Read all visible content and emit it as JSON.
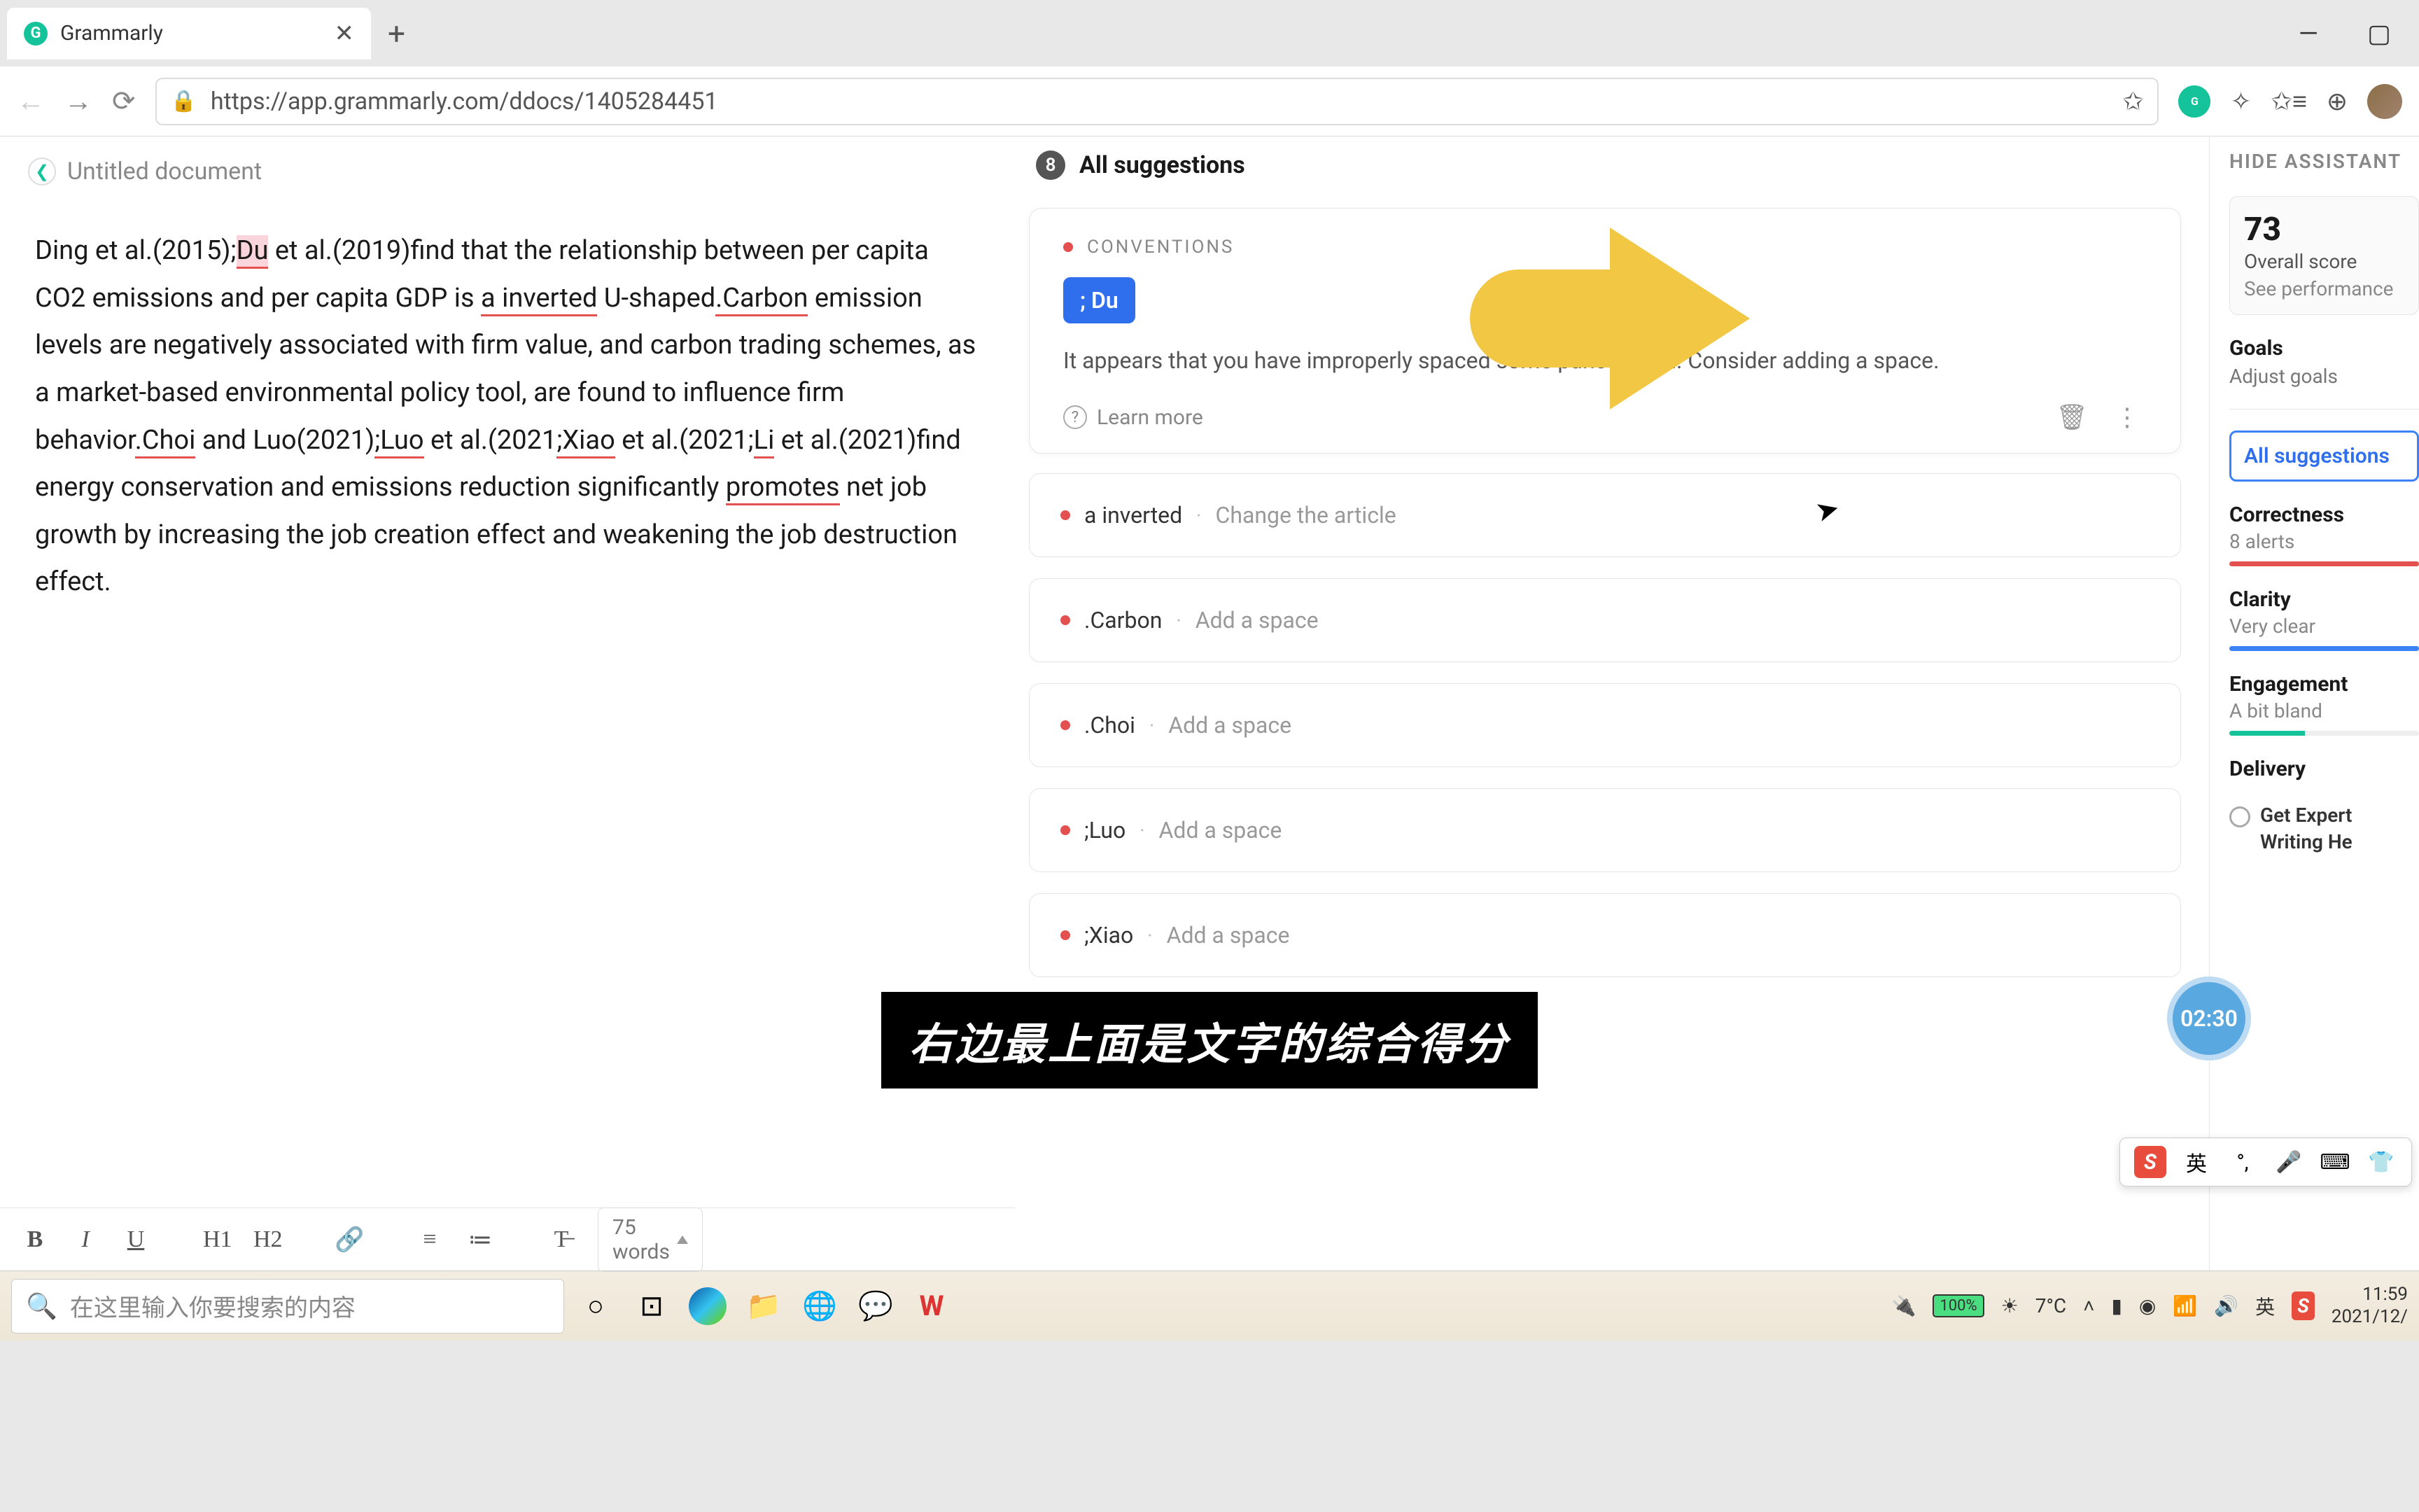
{
  "browser": {
    "tab_title": "Grammarly",
    "url": "https://app.grammarly.com/ddocs/1405284451",
    "window_minimize": "—",
    "window_maximize": "▢"
  },
  "doc": {
    "title": "Untitled document",
    "text_parts": {
      "p1a": "Ding et al.(2015);",
      "p1_du": "Du",
      "p1b": " et al.(2019)find that the relationship between per capita CO2 emissions and per capita GDP is ",
      "p1_a_inverted": "a inverted",
      "p1c": " U-shaped",
      "p1_carbon": ".Carbon",
      "p1d": " emission levels are negatively associated with firm value, and carbon trading schemes, as a market-based environmental policy tool, are found to influence firm behavior",
      "p1_choi": ".Choi",
      "p1e": " and Luo(2021)",
      "p1_luo": ";Luo",
      "p1f": " et al.(2021",
      "p1_xiao": ";Xiao",
      "p1g": " et al.(2021;",
      "p1_li": "Li",
      "p1h": " et al.(2021)find energy conservation and emissions reduction significantly ",
      "p1_promotes": "promotes",
      "p1i": " net job growth by increasing the job creation effect and weakening the job destruction effect."
    }
  },
  "toolbar": {
    "bold": "B",
    "italic": "I",
    "underline": "U",
    "h1": "H1",
    "h2": "H2",
    "link": "🔗",
    "ol": "≡",
    "ul": "≔",
    "clear": "T̶",
    "word_count": "75 words"
  },
  "suggestions": {
    "count": "8",
    "title": "All suggestions",
    "expanded": {
      "category": "CONVENTIONS",
      "fix": "; Du",
      "message": "It appears that you have improperly spaced some punctuation. Consider adding a space.",
      "learn_more": "Learn more"
    },
    "items": [
      {
        "term": "a inverted",
        "action": "Change the article"
      },
      {
        "term": ".Carbon",
        "action": "Add a space"
      },
      {
        "term": ".Choi",
        "action": "Add a space"
      },
      {
        "term": ";Luo",
        "action": "Add a space"
      },
      {
        "term": ";Xiao",
        "action": "Add a space"
      }
    ]
  },
  "assistant": {
    "hide": "HIDE ASSISTANT",
    "score": "73",
    "score_label": "Overall score",
    "score_link": "See performance",
    "goals_t": "Goals",
    "goals_s": "Adjust goals",
    "all_sugg": "All suggestions",
    "metrics": {
      "correctness_t": "Correctness",
      "correctness_s": "8 alerts",
      "clarity_t": "Clarity",
      "clarity_s": "Very clear",
      "engagement_t": "Engagement",
      "engagement_s": "A bit bland",
      "delivery_t": "Delivery"
    },
    "expert": "Get Expert Writing He"
  },
  "overlay": {
    "subtitle": "右边最上面是文字的综合得分",
    "timer": "02:30"
  },
  "ime": {
    "lang": "英",
    "punct": "°,",
    "shirt": "👕"
  },
  "taskbar": {
    "search_placeholder": "在这里输入你要搜索的内容",
    "weather": "7°C",
    "battery": "100%",
    "lang": "英",
    "time": "11:59",
    "date": "2021/12/"
  }
}
